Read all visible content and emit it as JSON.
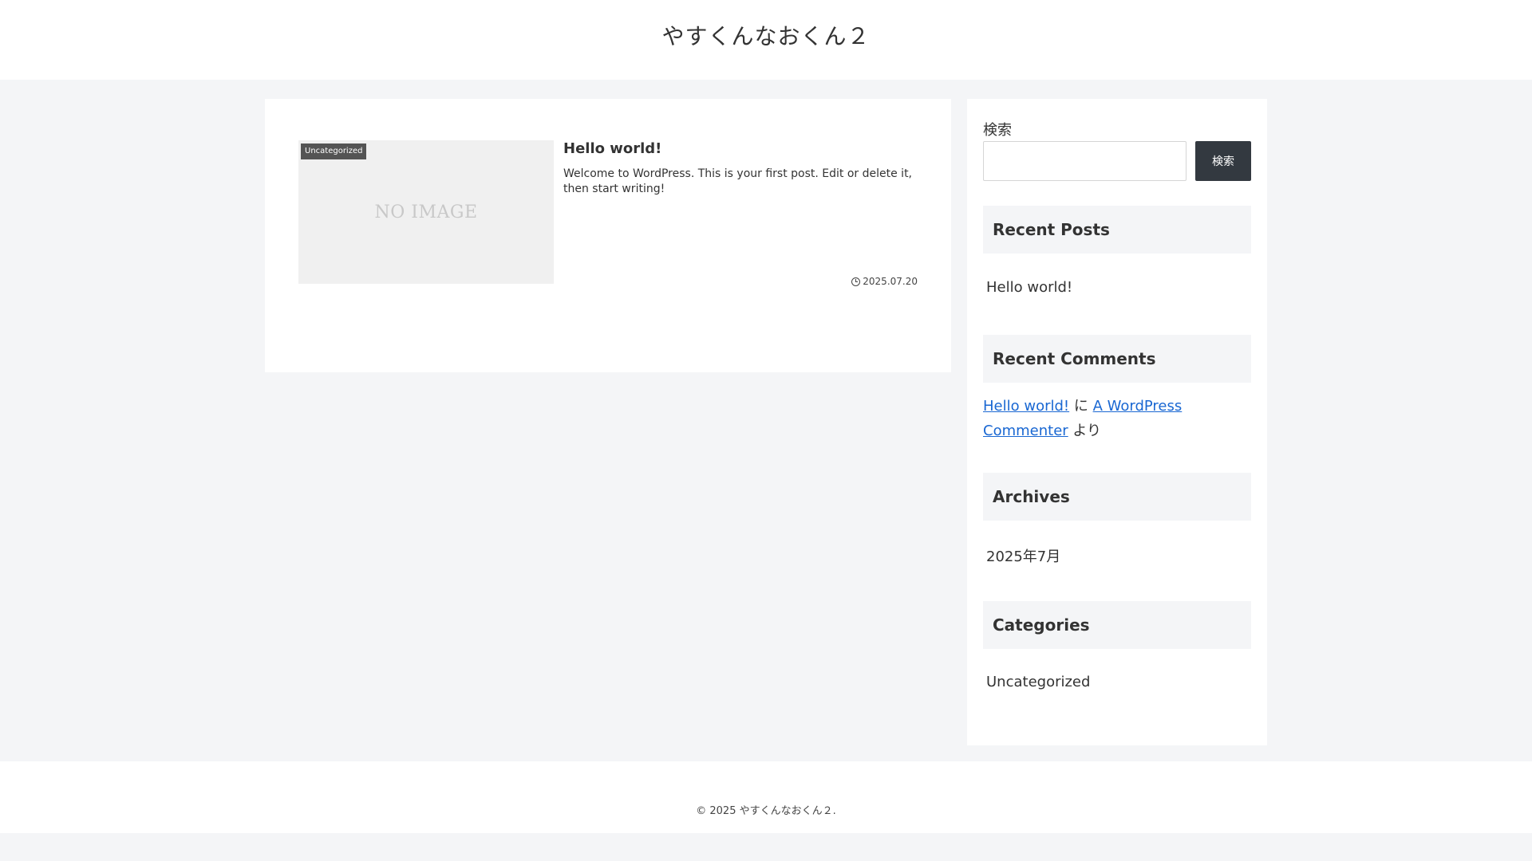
{
  "header": {
    "site_title": "やすくんなおくん２"
  },
  "main": {
    "post": {
      "category": "Uncategorized",
      "thumbnail_text": "NO IMAGE",
      "title": "Hello world!",
      "excerpt": "Welcome to WordPress. This is your first post. Edit or delete it, then start writing!",
      "date": "2025.07.20",
      "date_icon": "clock-icon"
    }
  },
  "sidebar": {
    "search": {
      "label": "検索",
      "input_value": "",
      "button_label": "検索"
    },
    "recent_posts": {
      "title": "Recent Posts",
      "items": [
        "Hello world!"
      ]
    },
    "recent_comments": {
      "title": "Recent Comments",
      "post_link": "Hello world!",
      "connector": " に ",
      "author_link": "A WordPress Commenter",
      "suffix": " より"
    },
    "archives": {
      "title": "Archives",
      "items": [
        "2025年7月"
      ]
    },
    "categories": {
      "title": "Categories",
      "items": [
        "Uncategorized"
      ]
    }
  },
  "footer": {
    "copyright": "© 2025 やすくんなおくん２."
  },
  "colors": {
    "background": "#f4f5f7",
    "button": "#333940",
    "link": "#1967d2",
    "category_label": "#545454"
  }
}
